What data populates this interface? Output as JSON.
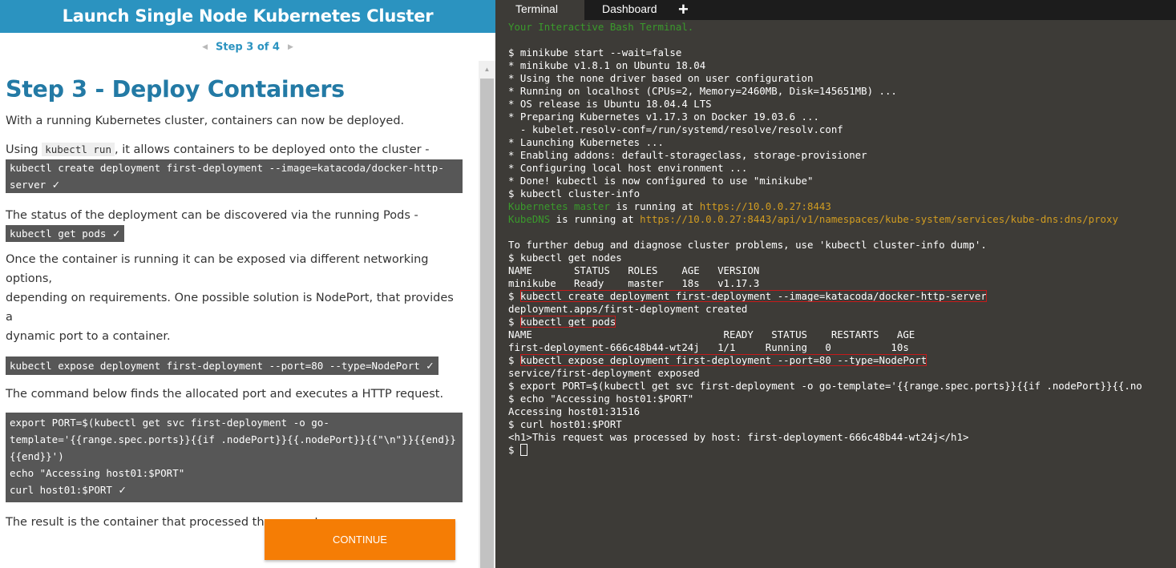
{
  "scenario": {
    "title": "Launch Single Node Kubernetes Cluster",
    "step_label": "Step 3 of 4",
    "heading": "Step 3 - Deploy Containers",
    "intro": "With a running Kubernetes cluster, containers can now be deployed.",
    "using_prefix": "Using",
    "using_code": "kubectl run",
    "using_suffix": ", it allows containers to be deployed onto the cluster -",
    "cmd_create_line1": "kubectl create deployment first-deployment --image=katacoda/docker-http-",
    "cmd_create_line2": "server",
    "status_text": "The status of the deployment can be discovered via the running Pods -",
    "cmd_get_pods": "kubectl get pods",
    "expose_text_line1": "Once the container is running it can be exposed via different networking options,",
    "expose_text_line2": "depending on requirements. One possible solution is NodePort, that provides a",
    "expose_text_line3": "dynamic port to a container.",
    "cmd_expose": "kubectl expose deployment first-deployment --port=80 --type=NodePort",
    "port_text": "The command below finds the allocated port and executes a HTTP request.",
    "cmd_port_lines": [
      "export PORT=$(kubectl get svc first-deployment -o go-",
      "template='{{range.spec.ports}}{{if .nodePort}}{{.nodePort}}{{\"\\n\"}}{{end}}",
      "{{end}}')",
      "echo \"Accessing host01:$PORT\"",
      "curl host01:$PORT"
    ],
    "result_text": "The result is the container that processed the request.",
    "check": "✓",
    "continue_label": "CONTINUE"
  },
  "terminal": {
    "tabs": [
      "Terminal",
      "Dashboard",
      "+"
    ],
    "lines": [
      {
        "t": "Your Interactive Bash Terminal.",
        "c": "g"
      },
      {
        "t": ""
      },
      {
        "t": "$ minikube start --wait=false"
      },
      {
        "t": "* minikube v1.8.1 on Ubuntu 18.04"
      },
      {
        "t": "* Using the none driver based on user configuration"
      },
      {
        "t": "* Running on localhost (CPUs=2, Memory=2460MB, Disk=145651MB) ..."
      },
      {
        "t": "* OS release is Ubuntu 18.04.4 LTS"
      },
      {
        "t": "* Preparing Kubernetes v1.17.3 on Docker 19.03.6 ..."
      },
      {
        "t": "  - kubelet.resolv-conf=/run/systemd/resolve/resolv.conf"
      },
      {
        "t": "* Launching Kubernetes ..."
      },
      {
        "t": "* Enabling addons: default-storageclass, storage-provisioner"
      },
      {
        "t": "* Configuring local host environment ..."
      },
      {
        "t": "* Done! kubectl is now configured to use \"minikube\""
      },
      {
        "t": "$ kubectl cluster-info"
      },
      {
        "parts": [
          {
            "t": "Kubernetes master",
            "c": "g"
          },
          {
            "t": " is running at "
          },
          {
            "t": "https://10.0.0.27:8443",
            "c": "y"
          }
        ]
      },
      {
        "parts": [
          {
            "t": "KubeDNS",
            "c": "g"
          },
          {
            "t": " is running at "
          },
          {
            "t": "https://10.0.0.27:8443/api/v1/namespaces/kube-system/services/kube-dns:dns/proxy",
            "c": "y"
          }
        ]
      },
      {
        "t": ""
      },
      {
        "t": "To further debug and diagnose cluster problems, use 'kubectl cluster-info dump'."
      },
      {
        "t": "$ kubectl get nodes"
      },
      {
        "t": "NAME       STATUS   ROLES    AGE   VERSION"
      },
      {
        "t": "minikube   Ready    master   18s   v1.17.3"
      },
      {
        "parts": [
          {
            "t": "$ "
          },
          {
            "t": "kubectl create deployment first-deployment --image=katacoda/docker-http-server",
            "c": "hl"
          }
        ]
      },
      {
        "t": "deployment.apps/first-deployment created"
      },
      {
        "parts": [
          {
            "t": "$ "
          },
          {
            "t": "kubectl get pods",
            "c": "hl"
          }
        ]
      },
      {
        "t": "NAME                                READY   STATUS    RESTARTS   AGE"
      },
      {
        "t": "first-deployment-666c48b44-wt24j   1/1     Running   0          10s"
      },
      {
        "parts": [
          {
            "t": "$ "
          },
          {
            "t": "kubectl expose deployment first-deployment --port=80 --type=NodePort",
            "c": "hl"
          }
        ]
      },
      {
        "t": "service/first-deployment exposed"
      },
      {
        "t": "$ export PORT=$(kubectl get svc first-deployment -o go-template='{{range.spec.ports}}{{if .nodePort}}{{.no"
      },
      {
        "t": "$ echo \"Accessing host01:$PORT\""
      },
      {
        "t": "Accessing host01:31516"
      },
      {
        "t": "$ curl host01:$PORT"
      },
      {
        "t": "<h1>This request was processed by host: first-deployment-666c48b44-wt24j</h1>"
      },
      {
        "t": "$ ",
        "cursor": true
      }
    ]
  }
}
